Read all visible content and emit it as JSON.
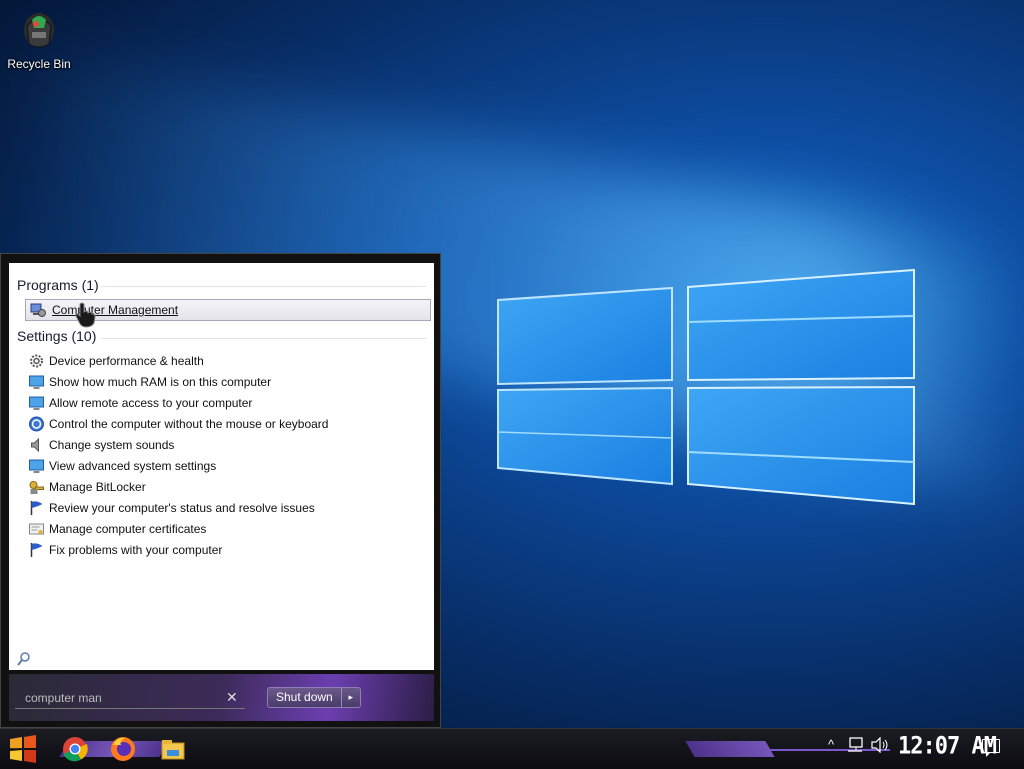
{
  "desktop": {
    "icons": [
      {
        "label": "Recycle Bin",
        "icon": "recycle-bin-icon"
      }
    ]
  },
  "start_menu": {
    "programs_header": "Programs (1)",
    "programs": [
      {
        "label": "Computer Management",
        "icon": "computer-management-icon"
      }
    ],
    "settings_header": "Settings (10)",
    "settings": [
      {
        "label": "Device performance & health",
        "icon": "gear-icon"
      },
      {
        "label": "Show how much RAM is on this computer",
        "icon": "monitor-icon"
      },
      {
        "label": "Allow remote access to your computer",
        "icon": "monitor-icon"
      },
      {
        "label": "Control the computer without the mouse or keyboard",
        "icon": "ease-of-access-icon"
      },
      {
        "label": "Change system sounds",
        "icon": "speaker-icon"
      },
      {
        "label": "View advanced system settings",
        "icon": "monitor-icon"
      },
      {
        "label": "Manage BitLocker",
        "icon": "bitlocker-key-icon"
      },
      {
        "label": "Review your computer's status and resolve issues",
        "icon": "flag-icon"
      },
      {
        "label": "Manage computer certificates",
        "icon": "certificate-icon"
      },
      {
        "label": "Fix problems with your computer",
        "icon": "flag-icon"
      }
    ],
    "search": {
      "value": "computer man",
      "clear_label": "✕"
    },
    "shutdown": {
      "label": "Shut down",
      "arrow": "▸"
    }
  },
  "taskbar": {
    "apps": [
      "chrome-icon",
      "firefox-icon",
      "file-explorer-icon"
    ],
    "tray": {
      "chevron": "^"
    },
    "clock": "12:07 AM"
  },
  "colors": {
    "desktop_blue": "#0d4ea3",
    "accent_purple": "#7b56cc"
  }
}
